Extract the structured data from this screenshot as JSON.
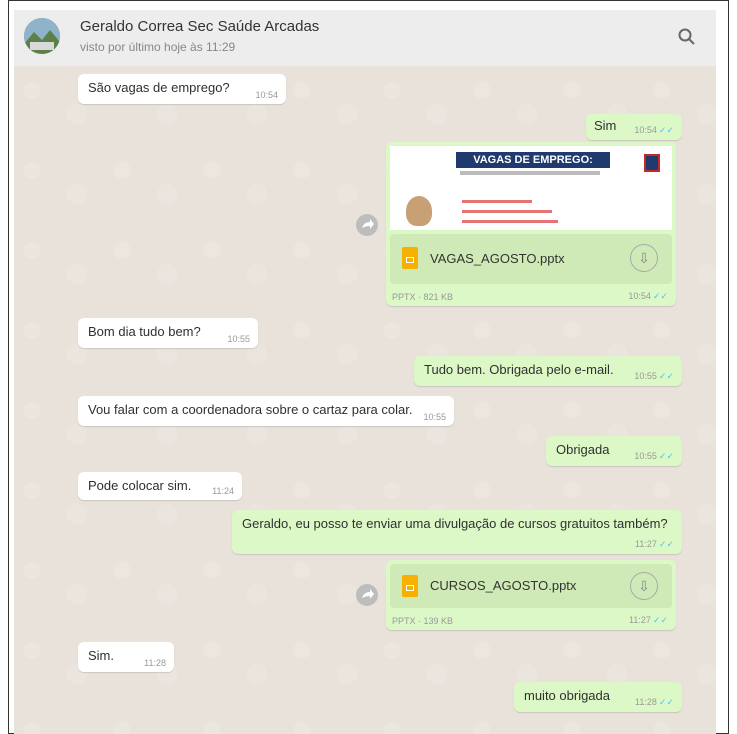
{
  "header": {
    "contact_name": "Geraldo Correa Sec Saúde Arcadas",
    "last_seen": "visto por último hoje às 11:29",
    "search_icon": "search-icon"
  },
  "colors": {
    "incoming": "#ffffff",
    "outgoing": "#dcf8c6",
    "ticks": "#4fc3f7"
  },
  "messages": [
    {
      "text": "São vagas de emprego?",
      "time": "10:54",
      "dir": "in"
    },
    {
      "text": "Sim",
      "time": "10:54",
      "dir": "out"
    },
    {
      "dir": "out",
      "type": "file",
      "preview_title": "VAGAS DE EMPREGO:",
      "file_name": "VAGAS_AGOSTO.pptx",
      "file_meta": "PPTX · 821 KB",
      "time": "10:54"
    },
    {
      "text": "Bom dia tudo bem?",
      "time": "10:55",
      "dir": "in"
    },
    {
      "text": "Tudo bem. Obrigada pelo e-mail.",
      "time": "10:55",
      "dir": "out"
    },
    {
      "text": "Vou falar com a coordenadora sobre o cartaz para colar.",
      "time": "10:55",
      "dir": "in"
    },
    {
      "text": "Obrigada",
      "time": "10:55",
      "dir": "out"
    },
    {
      "text": "Pode colocar sim.",
      "time": "11:24",
      "dir": "in"
    },
    {
      "text": "Geraldo, eu posso te enviar uma divulgação de cursos gratuitos também?",
      "time": "11:27",
      "dir": "out"
    },
    {
      "dir": "out",
      "type": "file",
      "file_name": "CURSOS_AGOSTO.pptx",
      "file_meta": "PPTX · 139 KB",
      "time": "11:27"
    },
    {
      "text": "Sim.",
      "time": "11:28",
      "dir": "in"
    },
    {
      "text": "muito obrigada",
      "time": "11:28",
      "dir": "out"
    }
  ],
  "ticks_glyph": "✓✓"
}
